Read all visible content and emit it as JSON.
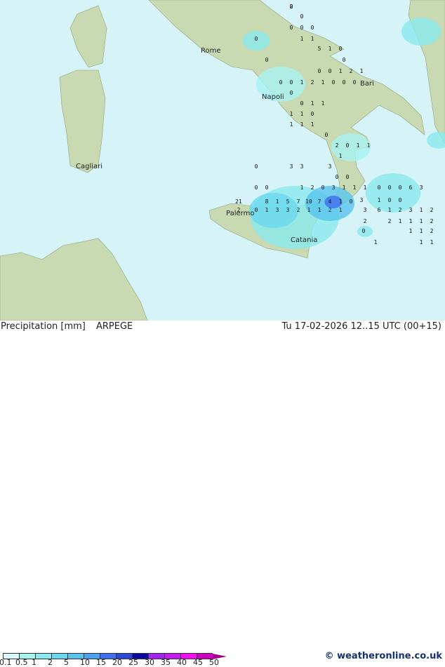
{
  "map": {
    "cities": [
      {
        "name": "Rome"
      },
      {
        "name": "Napoli"
      },
      {
        "name": "Bari"
      },
      {
        "name": "Cagliari"
      },
      {
        "name": "Palermo"
      },
      {
        "name": "Catania"
      }
    ],
    "precip_labels": [
      "0",
      "0",
      "0",
      "0",
      "0",
      "0",
      "1",
      "1",
      "5",
      "1",
      "0",
      "0",
      "0",
      "0",
      "1",
      "2",
      "1",
      "0",
      "0",
      "0",
      "1",
      "2",
      "1",
      "0",
      "0",
      "0",
      "0",
      "0",
      "1",
      "1",
      "1",
      "1",
      "0",
      "1",
      "1",
      "1",
      "0",
      "2",
      "0",
      "1",
      "1",
      "0",
      "3",
      "3",
      "3",
      "1",
      "0",
      "0",
      "0",
      "0",
      "1",
      "2",
      "0",
      "3",
      "1",
      "1",
      "1",
      "0",
      "0",
      "0",
      "6",
      "3",
      "21",
      "8",
      "1",
      "5",
      "7",
      "10",
      "7",
      "4",
      "1",
      "0",
      "3",
      "1",
      "0",
      "0",
      "2",
      "0",
      "1",
      "3",
      "3",
      "2",
      "1",
      "1",
      "2",
      "1",
      "3",
      "6",
      "1",
      "2",
      "3",
      "1",
      "2",
      "2",
      "2",
      "1",
      "1",
      "1",
      "2",
      "0",
      "1",
      "1",
      "2",
      "1",
      "1",
      "1",
      "2"
    ],
    "colors": {
      "sea": "#d6f3f7",
      "land": "#c9d9b1",
      "border": "#444444"
    }
  },
  "footer": {
    "title": "Precipitation [mm]",
    "model": "ARPEGE",
    "datetime": "Tu 17-02-2026 12..15 UTC (00+15)",
    "copyright": "© weatheronline.co.uk",
    "legend": {
      "ticks": [
        "0.1",
        "0.5",
        "1",
        "2",
        "5",
        "10",
        "15",
        "20",
        "25",
        "30",
        "35",
        "40",
        "45",
        "50"
      ],
      "colors": [
        "#d8fafa",
        "#a8f2f2",
        "#8ae8ee",
        "#6ad8ee",
        "#58c4ee",
        "#4ca2ee",
        "#3f6ef0",
        "#2a48d4",
        "#0a0aa0",
        "#a224f0",
        "#c41cf0",
        "#f010f0",
        "#d000c0"
      ],
      "arrow_color": "#a00090"
    }
  }
}
